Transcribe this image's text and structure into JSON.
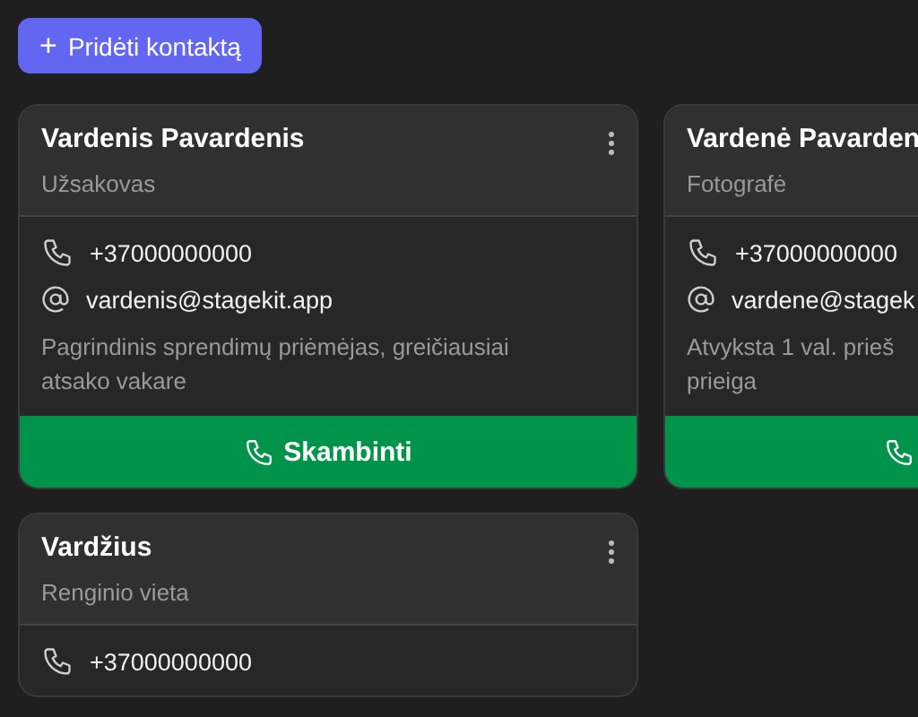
{
  "add_button": {
    "icon": "+",
    "label": "Pridėti kontaktą"
  },
  "contacts": [
    {
      "name": "Vardenis Pavardenis",
      "role": "Užsakovas",
      "phone": "+37000000000",
      "email": "vardenis@stagekit.app",
      "note": "Pagrindinis sprendimų priėmėjas, greičiausiai\natsako vakare",
      "call_label": "Skambinti"
    },
    {
      "name": "Vardenė Pavarden",
      "role": "Fotografė",
      "phone": "+37000000000",
      "email": "vardene@stagek",
      "note": "Atvyksta 1 val. prieš\nprieiga"
    },
    {
      "name": "Vardžius",
      "role": "Renginio vieta",
      "phone": "+37000000000"
    }
  ]
}
